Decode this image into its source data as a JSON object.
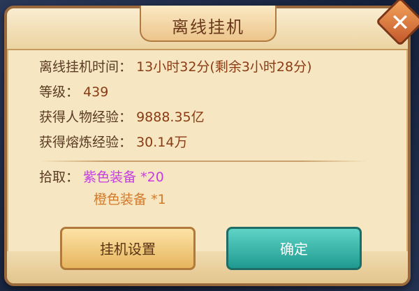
{
  "dialog": {
    "title": "离线挂机",
    "close_symbol": "✕"
  },
  "stats": {
    "offline_time_label": "离线挂机时间：",
    "offline_time_value": "13小时32分(剩余3小时28分)",
    "level_label": "等级：",
    "level_value": "439",
    "char_exp_label": "获得人物经验：",
    "char_exp_value": "9888.35亿",
    "smelt_exp_label": "获得熔炼经验：",
    "smelt_exp_value": "30.14万"
  },
  "loot": {
    "label": "拾取：",
    "items": [
      {
        "text": "紫色装备 *20",
        "color": "#c53de0"
      },
      {
        "text": "橙色装备 *1",
        "color": "#d3792a"
      }
    ]
  },
  "buttons": {
    "settings_label": "挂机设置",
    "confirm_label": "确定"
  }
}
